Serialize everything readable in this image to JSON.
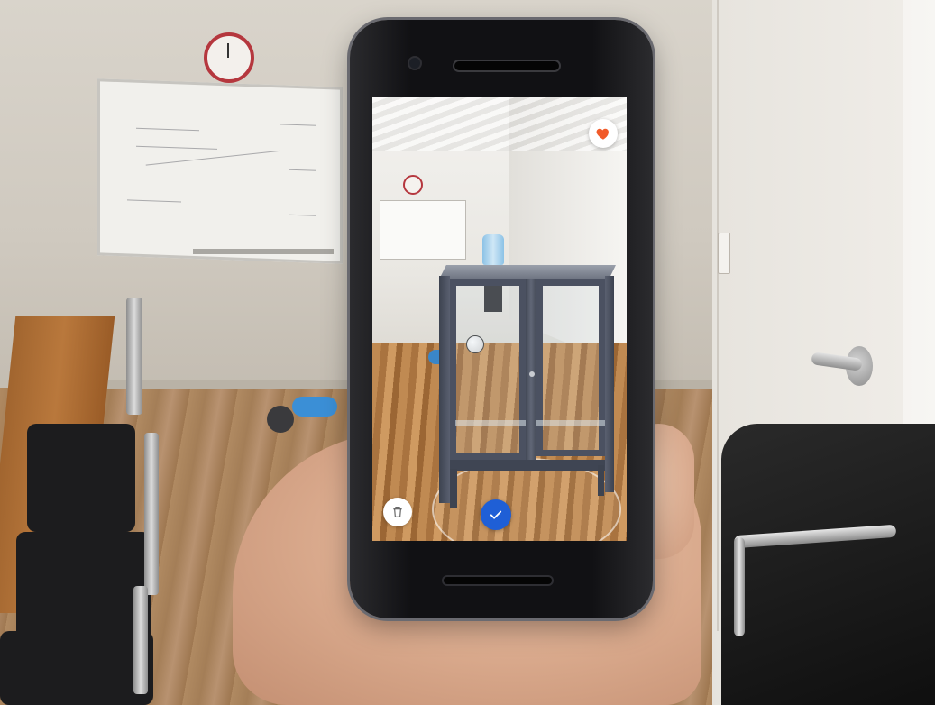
{
  "ar_app": {
    "favorite_icon": "heart-icon",
    "favorite_color": "#f15a29",
    "delete_icon": "trash-icon",
    "confirm_icon": "checkmark-icon",
    "confirm_color": "#1f5fd6",
    "placed_object": "glass-door-cabinet"
  }
}
